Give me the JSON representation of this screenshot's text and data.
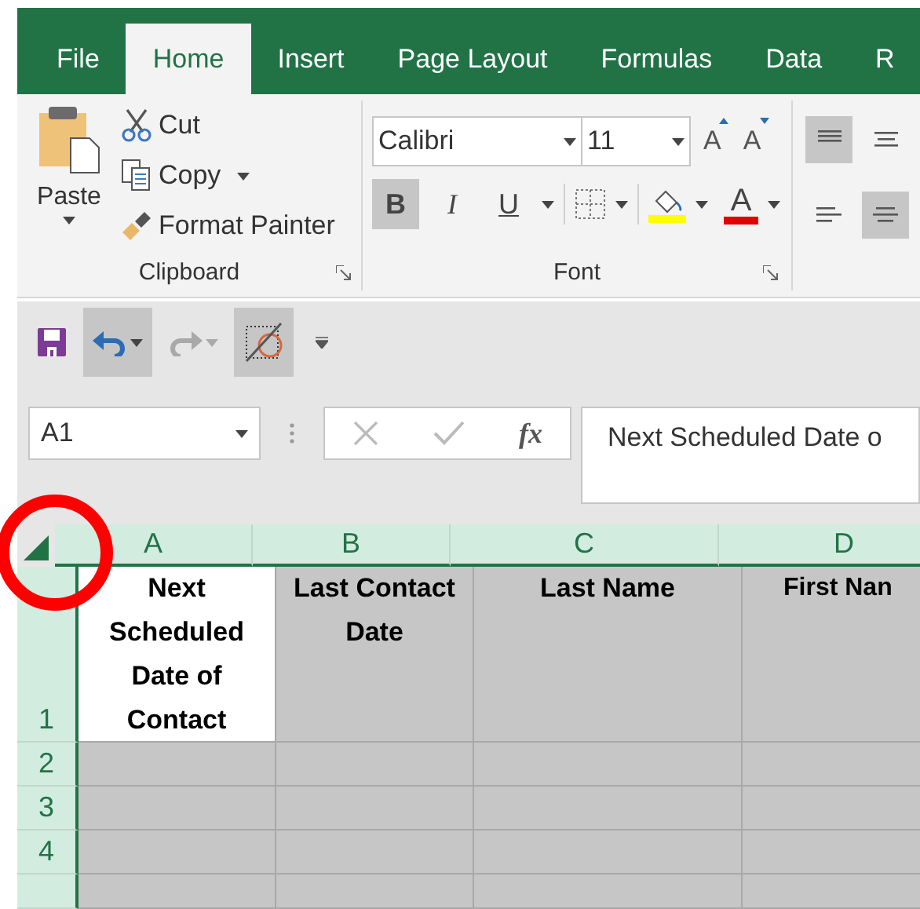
{
  "tabs": [
    {
      "label": "File",
      "selected": false
    },
    {
      "label": "Home",
      "selected": true
    },
    {
      "label": "Insert",
      "selected": false
    },
    {
      "label": "Page Layout",
      "selected": false
    },
    {
      "label": "Formulas",
      "selected": false
    },
    {
      "label": "Data",
      "selected": false
    },
    {
      "label": "R",
      "selected": false
    }
  ],
  "clipboard": {
    "paste": "Paste",
    "cut": "Cut",
    "copy": "Copy",
    "format_painter": "Format Painter",
    "label": "Clipboard"
  },
  "font": {
    "name": "Calibri",
    "size": "11",
    "grow": "A",
    "shrink": "A",
    "styles": [
      {
        "label": "B",
        "selected": true
      },
      {
        "label": "I",
        "selected": false
      },
      {
        "label": "U",
        "selected": false
      }
    ],
    "font_color": "A",
    "label": "Font"
  },
  "alignment": [
    {
      "kind": "top",
      "selected": true
    },
    {
      "kind": "middle",
      "selected": false
    },
    {
      "kind": "left",
      "selected": false
    },
    {
      "kind": "center",
      "selected": true
    }
  ],
  "quick_access": [
    {
      "kind": "save",
      "selected": false
    },
    {
      "kind": "undo",
      "selected": true
    },
    {
      "kind": "redo",
      "selected": false
    },
    {
      "kind": "clear",
      "selected": true
    }
  ],
  "formula_bar": {
    "name_box": "A1",
    "function_label": "fx",
    "content": "Next Scheduled Date o"
  },
  "sheet": {
    "columns": [
      "A",
      "B",
      "C",
      "D"
    ],
    "rows": [
      {
        "number": "1",
        "cells": [
          {
            "value": "Next Scheduled Date of Contact",
            "active": true
          },
          {
            "value": "Last Contact Date",
            "active": false
          },
          {
            "value": "Last Name",
            "active": false
          },
          {
            "value": "First Nan",
            "active": false
          }
        ]
      },
      {
        "number": "2",
        "cells": [
          {
            "active": false
          },
          {
            "active": false
          },
          {
            "active": false
          },
          {
            "active": false
          }
        ]
      },
      {
        "number": "3",
        "cells": [
          {
            "active": false
          },
          {
            "active": false
          },
          {
            "active": false
          },
          {
            "active": false
          }
        ]
      },
      {
        "number": "4",
        "cells": [
          {
            "active": false
          },
          {
            "active": false
          },
          {
            "active": false
          },
          {
            "active": false
          }
        ]
      },
      {
        "cells": [
          {
            "active": false
          },
          {
            "active": false
          },
          {
            "active": false
          },
          {
            "active": false
          }
        ]
      }
    ]
  }
}
